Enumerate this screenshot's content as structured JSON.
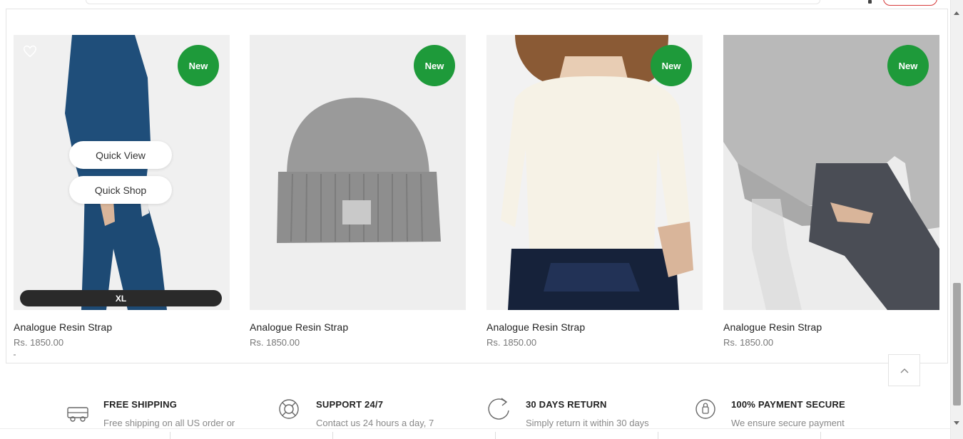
{
  "products": [
    {
      "title": "Analogue Resin Strap",
      "price": "Rs. 1850.00",
      "badge": "New"
    },
    {
      "title": "Analogue Resin Strap",
      "price": "Rs. 1850.00",
      "badge": "New"
    },
    {
      "title": "Analogue Resin Strap",
      "price": "Rs. 1850.00",
      "badge": "New"
    },
    {
      "title": "Analogue Resin Strap",
      "price": "Rs. 1850.00",
      "badge": "New"
    }
  ],
  "hover_actions": {
    "quick_view": "Quick View",
    "quick_shop": "Quick Shop",
    "size": "XL"
  },
  "features": [
    {
      "icon": "truck-icon",
      "title": "FREE SHIPPING",
      "desc": "Free shipping on all US order or"
    },
    {
      "icon": "lifebuoy-icon",
      "title": "SUPPORT 24/7",
      "desc": "Contact us 24 hours a day, 7"
    },
    {
      "icon": "return-arrow-icon",
      "title": "30 DAYS RETURN",
      "desc": "Simply return it within 30 days"
    },
    {
      "icon": "secure-payment-icon",
      "title": "100% PAYMENT SECURE",
      "desc": "We ensure secure payment"
    }
  ],
  "colors": {
    "badge": "#1e9a3a",
    "size_bar": "#2a2a2a",
    "price": "#777777"
  }
}
